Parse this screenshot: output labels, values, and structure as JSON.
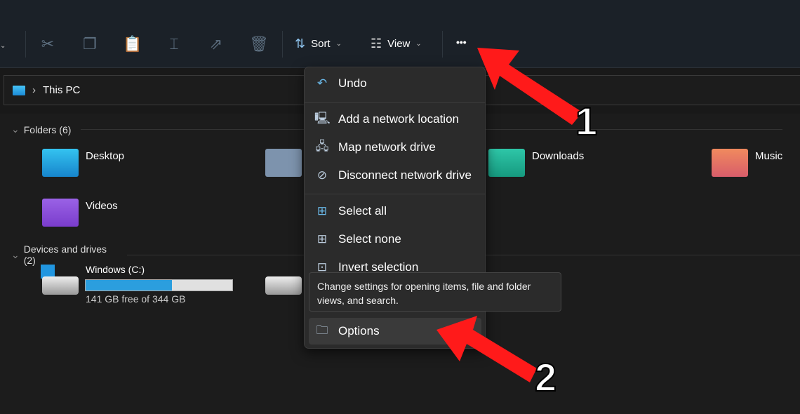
{
  "toolbar": {
    "sort_label": "Sort",
    "view_label": "View",
    "more_label": "•••"
  },
  "address": {
    "path": "This PC"
  },
  "sections": {
    "folders": "Folders (6)",
    "devices": "Devices and drives (2)"
  },
  "folders": [
    {
      "label": "Desktop",
      "color": "#1ea4e0"
    },
    {
      "label": "Downloads",
      "color": "#1fae94"
    },
    {
      "label": "Music",
      "color": "#e8735a"
    },
    {
      "label": "Videos",
      "color": "#8c4fd8"
    }
  ],
  "drive": {
    "label": "Windows (C:)",
    "free_text": "141 GB free of 344 GB",
    "used_percent": 59
  },
  "menu": {
    "items": [
      "Undo",
      "Add a network location",
      "Map network drive",
      "Disconnect network drive",
      "Select all",
      "Select none",
      "Invert selection",
      "Options"
    ]
  },
  "tooltip": "Change settings for opening items, file and folder views, and search.",
  "annotations": {
    "step1": "1",
    "step2": "2",
    "arrow_color": "#ff1a1a"
  }
}
